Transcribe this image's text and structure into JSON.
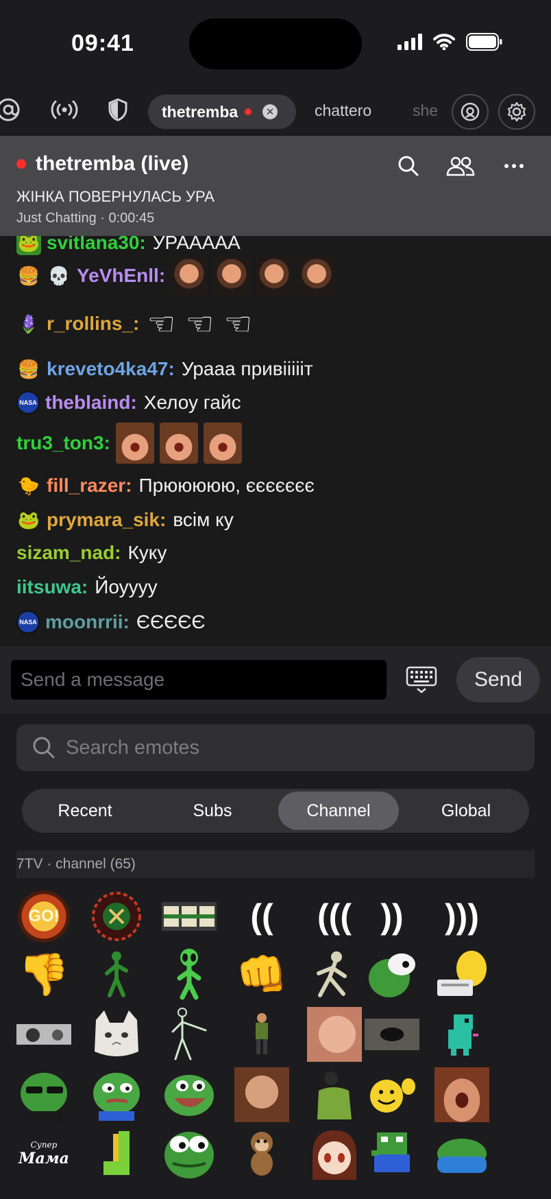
{
  "status_bar": {
    "time": "09:41"
  },
  "tabs": {
    "active": {
      "label": "thetremba"
    },
    "items": [
      {
        "label": "chattero"
      },
      {
        "label": "she"
      }
    ]
  },
  "stream": {
    "title": "thetremba (live)",
    "subtitle": "ЖІНКА ПОВЕРНУЛАСЬ УРА",
    "meta": "Just Chatting · 0:00:45"
  },
  "chat": {
    "messages": [
      {
        "user": "svitlana30:",
        "text": "УРААААА",
        "color": "#2fd13a"
      },
      {
        "user": "YeVhEnll:",
        "text": "",
        "color": "#b98cf0"
      },
      {
        "user": "r_rollins_:",
        "text": "",
        "color": "#e0a73b"
      },
      {
        "user": "kreveto4ka47:",
        "text": "Урааа привіііііт",
        "color": "#6fa4e6"
      },
      {
        "user": "theblaind:",
        "text": "Хелоу гайс",
        "color": "#b98cf0"
      },
      {
        "user": "tru3_ton3:",
        "text": "",
        "color": "#2fd13a"
      },
      {
        "user": "fill_razer:",
        "text": "Прююююю, єєєєєєє",
        "color": "#ff8a5b"
      },
      {
        "user": "prymara_sik:",
        "text": "всім ку",
        "color": "#e0a73b"
      },
      {
        "user": "sizam_nad:",
        "text": "Куку",
        "color": "#9acd32"
      },
      {
        "user": "iitsuwa:",
        "text": "Йоуууу",
        "color": "#3dc98a"
      },
      {
        "user": "moonrrii:",
        "text": "ЄЄЄЄЄ",
        "color": "#5f9ea0"
      }
    ]
  },
  "composer": {
    "placeholder": "Send a message",
    "send_label": "Send"
  },
  "emotes": {
    "search_placeholder": "Search emotes",
    "segments": [
      "Recent",
      "Subs",
      "Channel",
      "Global"
    ],
    "active_segment": "Channel",
    "section_label": "7TV · channel (65)",
    "grid_labels": {
      "go": "GO!",
      "paren2": "((",
      "paren3": "(((",
      "close2": "))",
      "close3": ")))",
      "mama_top": "Супер",
      "mama": "Мама"
    }
  }
}
